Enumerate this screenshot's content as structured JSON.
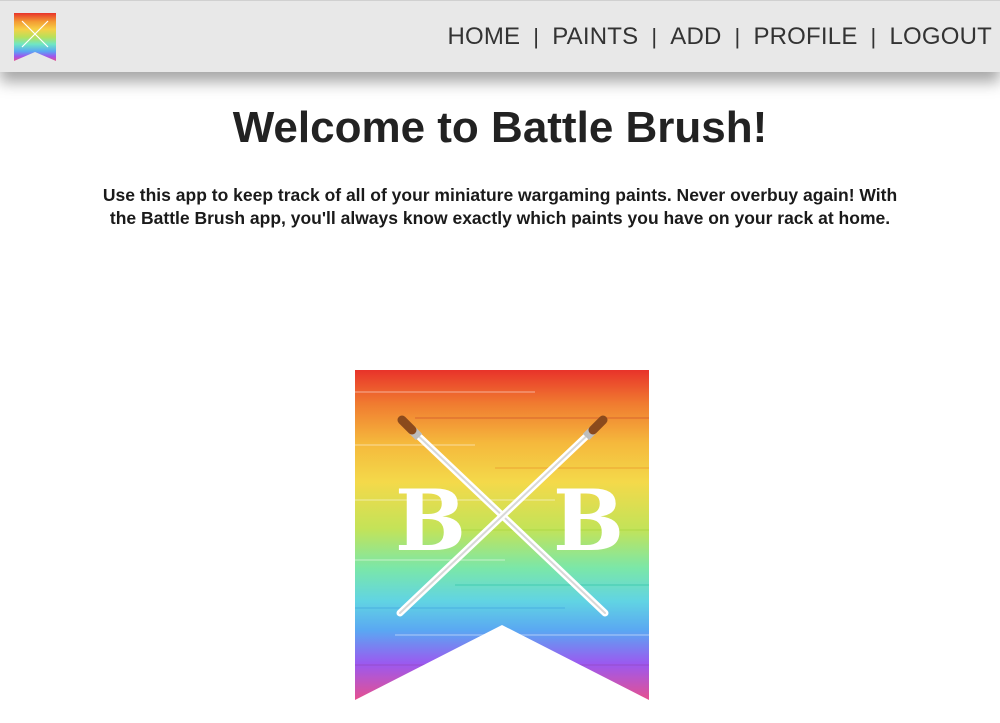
{
  "nav": {
    "links": [
      "HOME",
      "PAINTS",
      "ADD",
      "PROFILE",
      "LOGOUT"
    ],
    "separator": "|"
  },
  "main": {
    "title": "Welcome to Battle Brush!",
    "intro": "Use this app to keep track of all of your miniature wargaming paints. Never overbuy again! With the Battle Brush app, you'll always know exactly which paints you have on your rack at home."
  },
  "logo": {
    "lettering": "B B",
    "colors": [
      "#e8332a",
      "#f39c33",
      "#f7d046",
      "#b8e05a",
      "#6fe7c4",
      "#5aa7f2",
      "#9b59f0",
      "#e6508f"
    ]
  }
}
